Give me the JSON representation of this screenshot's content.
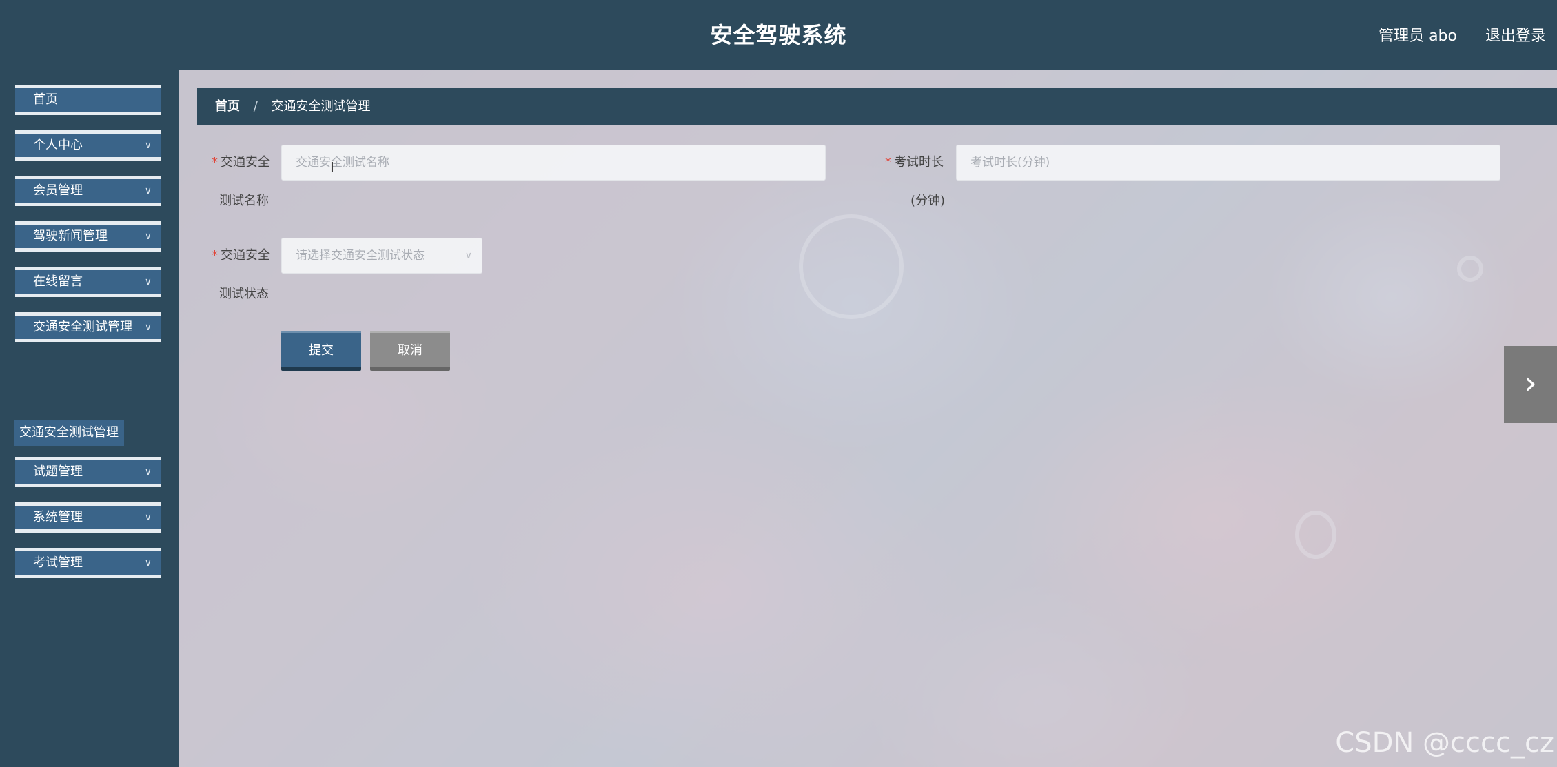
{
  "header": {
    "title": "安全驾驶系统",
    "user": "管理员 abo",
    "logout": "退出登录"
  },
  "sidebar": {
    "items": [
      {
        "label": "首页",
        "has_chevron": false
      },
      {
        "label": "个人中心",
        "has_chevron": true
      },
      {
        "label": "会员管理",
        "has_chevron": true
      },
      {
        "label": "驾驶新闻管理",
        "has_chevron": true
      },
      {
        "label": "在线留言",
        "has_chevron": true
      },
      {
        "label": "交通安全测试管理",
        "has_chevron": true
      },
      {
        "label": "试题管理",
        "has_chevron": true
      },
      {
        "label": "系统管理",
        "has_chevron": true
      },
      {
        "label": "考试管理",
        "has_chevron": true
      }
    ],
    "open_submenu": {
      "label": "交通安全测试管理"
    },
    "chevron_icon": "chevron-down-icon"
  },
  "breadcrumb": {
    "home": "首页",
    "separator": "/",
    "current": "交通安全测试管理"
  },
  "form": {
    "name_label_line1": "交通安全",
    "name_label_line2": "测试名称",
    "name_placeholder": "交通安全测试名称",
    "duration_label_line1": "考试时长",
    "duration_label_line2": "(分钟)",
    "duration_placeholder": "考试时长(分钟)",
    "status_label_line1": "交通安全",
    "status_label_line2": "测试状态",
    "status_placeholder": "请选择交通安全测试状态",
    "required_mark": "*"
  },
  "buttons": {
    "submit": "提交",
    "cancel": "取消"
  },
  "watermark": "CSDN @cccc_cz",
  "colors": {
    "header_bg": "#2d4a5c",
    "menu_item_bg": "#3a6489",
    "required": "#e0463a"
  }
}
